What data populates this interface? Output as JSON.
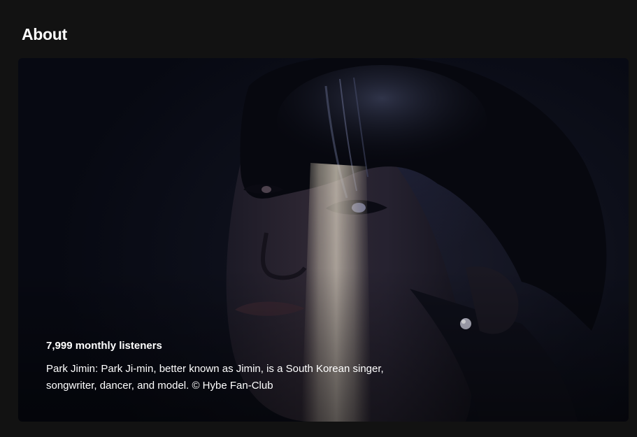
{
  "about": {
    "title": "About",
    "monthly_listeners": "7,999 monthly listeners",
    "bio": "Park Jimin: Park Ji-min, better known as Jimin, is a South Korean singer, songwriter, dancer, and model. © Hybe Fan-Club"
  },
  "colors": {
    "background": "#121212",
    "text": "#ffffff",
    "card_dark": "#0d0f1a"
  }
}
